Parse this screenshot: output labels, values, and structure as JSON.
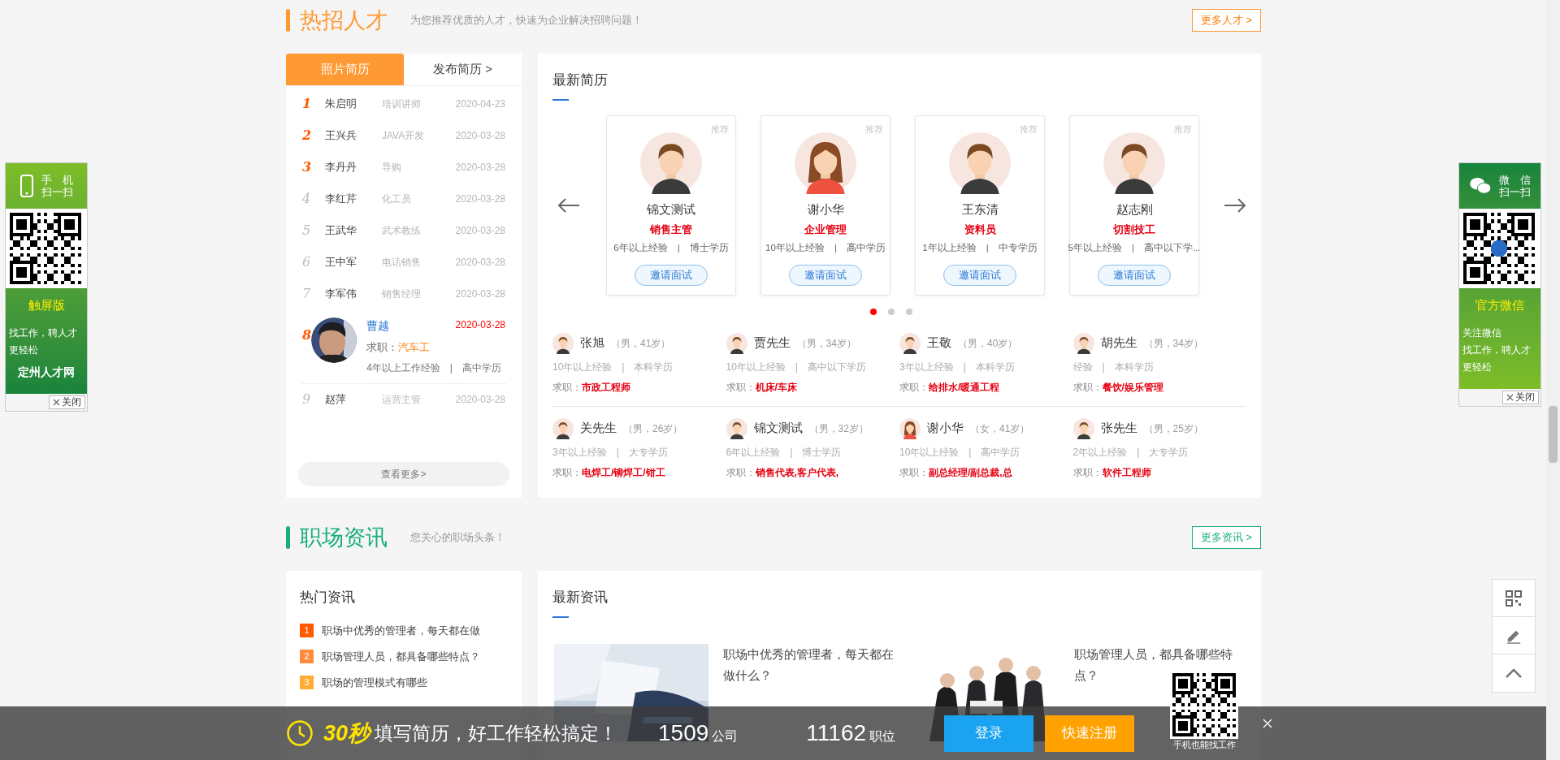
{
  "talent_section": {
    "title": "热招人才",
    "subtitle": "为您推荐优质的人才，快速为企业解决招聘问题！",
    "more_link": "更多人才 >"
  },
  "resume_tabs": [
    {
      "label": "照片简历",
      "selected": true
    },
    {
      "label": "发布简历 >",
      "selected": false
    }
  ],
  "resume_list": [
    {
      "rank": "1",
      "name": "朱启明",
      "job": "培训讲师",
      "date": "2020-04-23",
      "top": true,
      "expanded": false
    },
    {
      "rank": "2",
      "name": "王兴兵",
      "job": "JAVA开发",
      "date": "2020-03-28",
      "top": true,
      "expanded": false
    },
    {
      "rank": "3",
      "name": "李丹丹",
      "job": "导购",
      "date": "2020-03-28",
      "top": true,
      "expanded": false
    },
    {
      "rank": "4",
      "name": "李红芹",
      "job": "化工员",
      "date": "2020-03-28",
      "top": false,
      "expanded": false
    },
    {
      "rank": "5",
      "name": "王武华",
      "job": "武术教练",
      "date": "2020-03-28",
      "top": false,
      "expanded": false
    },
    {
      "rank": "6",
      "name": "王中军",
      "job": "电话销售",
      "date": "2020-03-28",
      "top": false,
      "expanded": false
    },
    {
      "rank": "7",
      "name": "李军伟",
      "job": "销售经理",
      "date": "2020-03-28",
      "top": false,
      "expanded": false
    },
    {
      "rank": "8",
      "name": "曹越",
      "job": "汽车工",
      "job_label": "求职：",
      "date": "2020-03-28",
      "detail": "4年以上工作经验　|　高中学历",
      "top": true,
      "expanded": true
    },
    {
      "rank": "9",
      "name": "赵萍",
      "job": "运营主管",
      "date": "2020-03-28",
      "top": false,
      "expanded": false
    }
  ],
  "view_more": "查看更多>",
  "latest_resumes": {
    "title": "最新简历",
    "cards": [
      {
        "badge": "推荐",
        "name": "锦文测试",
        "job": "销售主管",
        "info": "6年以上经验　|　博士学历",
        "button": "邀请面试",
        "kind": "male"
      },
      {
        "badge": "推荐",
        "name": "谢小华",
        "job": "企业管理",
        "info": "10年以上经验　|　高中学历",
        "button": "邀请面试",
        "kind": "female"
      },
      {
        "badge": "推荐",
        "name": "王东清",
        "job": "资料员",
        "info": "1年以上经验　|　中专学历",
        "button": "邀请面试",
        "kind": "male"
      },
      {
        "badge": "推荐",
        "name": "赵志刚",
        "job": "切割技工",
        "info": "5年以上经验　|　高中以下学...",
        "button": "邀请面试",
        "kind": "male"
      }
    ],
    "dots": [
      {
        "selected": true
      },
      {
        "selected": false
      },
      {
        "selected": false
      }
    ],
    "people": [
      {
        "name": "张旭",
        "meta": "（男，41岁）",
        "info": "10年以上经验　|　本科学历",
        "job_label": "求职：",
        "job": "市政工程师",
        "kind": "male"
      },
      {
        "name": "贾先生",
        "meta": "（男，34岁）",
        "info": "10年以上经验　|　高中以下学历",
        "job_label": "求职：",
        "job": "机床/车床",
        "kind": "male"
      },
      {
        "name": "王敬",
        "meta": "（男，40岁）",
        "info": "3年以上经验　|　本科学历",
        "job_label": "求职：",
        "job": "给排水/暖通工程",
        "kind": "male"
      },
      {
        "name": "胡先生",
        "meta": "（男，34岁）",
        "info": "经验　|　本科学历",
        "job_label": "求职：",
        "job": "餐饮/娱乐管理",
        "kind": "male"
      },
      {
        "name": "关先生",
        "meta": "（男，26岁）",
        "info": "3年以上经验　|　大专学历",
        "job_label": "求职：",
        "job": "电焊工/铆焊工/钳工",
        "kind": "male"
      },
      {
        "name": "锦文测试",
        "meta": "（男，32岁）",
        "info": "6年以上经验　|　博士学历",
        "job_label": "求职：",
        "job": "销售代表,客户代表,",
        "kind": "male"
      },
      {
        "name": "谢小华",
        "meta": "（女，41岁）",
        "info": "10年以上经验　|　高中学历",
        "job_label": "求职：",
        "job": "副总经理/副总裁,总",
        "kind": "female"
      },
      {
        "name": "张先生",
        "meta": "（男，25岁）",
        "info": "2年以上经验　|　大专学历",
        "job_label": "求职：",
        "job": "软件工程师",
        "kind": "male"
      }
    ]
  },
  "news_section": {
    "title": "职场资讯",
    "subtitle": "您关心的职场头条！",
    "more_link": "更多资讯 >"
  },
  "hot_news": {
    "title": "热门资讯",
    "items": [
      {
        "rank": "1",
        "title": "职场中优秀的管理者，每天都在做",
        "color": "#ff5a00"
      },
      {
        "rank": "2",
        "title": "职场管理人员，都具备哪些特点？",
        "color": "#ff8b3d"
      },
      {
        "rank": "3",
        "title": "职场的管理模式有哪些",
        "color": "#ffad33"
      }
    ]
  },
  "latest_news": {
    "title": "最新资讯",
    "articles": [
      {
        "title": "职场中优秀的管理者，每天都在做什么？"
      },
      {
        "title": "职场管理人员，都具备哪些特点？"
      }
    ]
  },
  "left_ad": {
    "heading": [
      "手　机",
      "扫一扫"
    ],
    "version": "触屏版",
    "slogan": [
      "找工作，聘人才更轻松"
    ],
    "site": "定州人才网",
    "close": "关闭"
  },
  "right_ad": {
    "heading": [
      "微　信",
      "扫一扫"
    ],
    "version": "官方微信",
    "slogan": [
      "关注微信",
      "找工作，聘人才更轻松"
    ],
    "close": "关闭"
  },
  "bottom_bar": {
    "highlight": "30秒",
    "tagline": "填写简历，好工作轻松搞定！",
    "stats": [
      {
        "value": "1509",
        "unit": "公司"
      },
      {
        "value": "11162",
        "unit": "职位"
      }
    ],
    "login": "登录",
    "register": "快速注册",
    "qr_caption": "手机也能找工作"
  }
}
